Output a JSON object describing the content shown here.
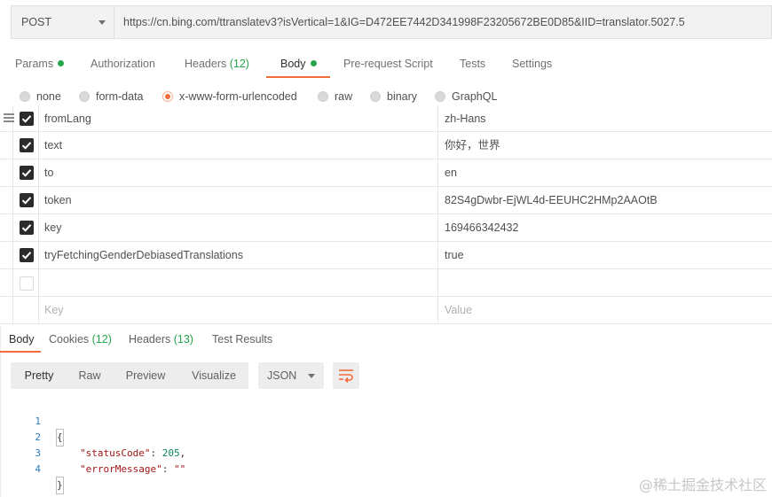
{
  "request": {
    "method": "POST",
    "url": "https://cn.bing.com/ttranslatev3?isVertical=1&IG=D472EE7442D341998F23205672BE0D85&IID=translator.5027.5"
  },
  "request_tabs": [
    {
      "label": "Params",
      "count": "",
      "dot": true
    },
    {
      "label": "Authorization",
      "count": "",
      "dot": false
    },
    {
      "label": "Headers",
      "count": "(12)",
      "dot": false
    },
    {
      "label": "Body",
      "count": "",
      "dot": true,
      "active": true
    },
    {
      "label": "Pre-request Script",
      "count": "",
      "dot": false
    },
    {
      "label": "Tests",
      "count": "",
      "dot": false
    },
    {
      "label": "Settings",
      "count": "",
      "dot": false
    }
  ],
  "body_types": [
    {
      "label": "none",
      "selected": false
    },
    {
      "label": "form-data",
      "selected": false
    },
    {
      "label": "x-www-form-urlencoded",
      "selected": true
    },
    {
      "label": "raw",
      "selected": false
    },
    {
      "label": "binary",
      "selected": false
    },
    {
      "label": "GraphQL",
      "selected": false
    }
  ],
  "params": [
    {
      "key": "fromLang",
      "value": "zh-Hans",
      "checked": true
    },
    {
      "key": "text",
      "value": "你好，世界",
      "checked": true
    },
    {
      "key": "to",
      "value": "en",
      "checked": true
    },
    {
      "key": "token",
      "value": "82S4gDwbr-EjWL4d-EEUHC2HMp2AAOtB",
      "checked": true
    },
    {
      "key": "key",
      "value": "169466342432",
      "checked": true
    },
    {
      "key": "tryFetchingGenderDebiasedTranslations",
      "value": "true",
      "checked": true
    }
  ],
  "new_row": {
    "key_placeholder": "Key",
    "value_placeholder": "Value"
  },
  "response_tabs": [
    {
      "label": "Body",
      "count": "",
      "active": true
    },
    {
      "label": "Cookies",
      "count": "(12)"
    },
    {
      "label": "Headers",
      "count": "(13)"
    },
    {
      "label": "Test Results",
      "count": ""
    }
  ],
  "view_modes": [
    "Pretty",
    "Raw",
    "Preview",
    "Visualize"
  ],
  "active_view": "Pretty",
  "format": "JSON",
  "response_lines": [
    {
      "no": "1",
      "text": "{"
    },
    {
      "no": "2",
      "key": "\"statusCode\"",
      "sep": ": ",
      "value": "205",
      "tail": ","
    },
    {
      "no": "3",
      "key": "\"errorMessage\"",
      "sep": ": ",
      "value": "\"\"",
      "tail": ""
    },
    {
      "no": "4",
      "text": "}"
    }
  ],
  "watermark": "@稀土掘金技术社区",
  "colors": {
    "accent": "#f26b3a",
    "success": "#26a54d"
  }
}
